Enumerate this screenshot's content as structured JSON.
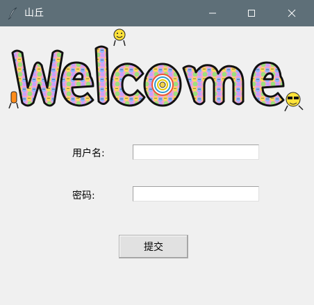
{
  "window": {
    "title": "山丘",
    "icon": "feather-icon",
    "controls": [
      "minimize-icon",
      "maximize-icon",
      "close-icon"
    ],
    "titlebar_color": "#5e6f78"
  },
  "banner": {
    "text": "Welcome",
    "style": "bubble letters with colorful smiley-face pattern"
  },
  "form": {
    "username_label": "用户名:",
    "username_value": "",
    "password_label": "密码:",
    "password_value": "",
    "submit_label": "提交"
  }
}
